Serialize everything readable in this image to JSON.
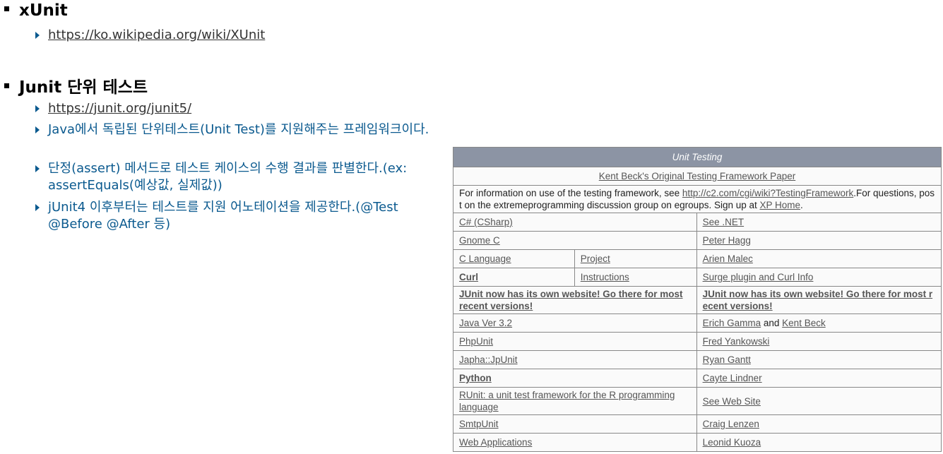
{
  "sections": [
    {
      "title": "xUnit",
      "bullets": [
        {
          "text": "https://ko.wikipedia.org/wiki/XUnit",
          "is_link": true
        }
      ]
    },
    {
      "title": "Junit 단위 테스트",
      "bullets": [
        {
          "text": "https://junit.org/junit5/",
          "is_link": true
        },
        {
          "text": "Java에서 독립된 단위테스트(Unit Test)를 지원해주는 프레임워크이다.",
          "is_link": false
        },
        {
          "text": "단정(assert) 메서드로 테스트 케이스의 수행 결과를 판별한다.(ex: assertEquals(예상값, 실제값))",
          "is_link": false
        },
        {
          "text": "jUnit4 이후부터는 테스트를 지원 어노테이션을 제공한다.(@Test @Before @After 등)",
          "is_link": false
        }
      ]
    }
  ],
  "table": {
    "header": "Unit Testing",
    "paper_link": "Kent Beck's Original Testing Framework Paper",
    "info": {
      "prefix": "For information on use of the testing framework, see ",
      "link1": "http://c2.com/cgi/wiki?TestingFramework",
      "middle": ".For questions, post on the extremeprogramming discussion group on egroups. Sign up at ",
      "link2": "XP Home",
      "suffix": "."
    },
    "rows": {
      "csharp": {
        "left": "C# (CSharp)",
        "right": "See .NET"
      },
      "gnome": {
        "left": "Gnome C",
        "right": "Peter Hagg"
      },
      "clang": {
        "left": "C Language",
        "mid": "Project",
        "right": "Arien Malec"
      },
      "curl": {
        "left": "Curl",
        "mid": "Instructions",
        "right": "Surge plugin and Curl Info"
      },
      "junit": {
        "left": "JUnit now has its own website! Go there for most recent versions!",
        "right": "JUnit now has its own website! Go there for most recent versions!"
      },
      "java": {
        "left": "Java Ver 3.2",
        "right_a": "Erich Gamma",
        "right_and": "and",
        "right_b": "Kent Beck"
      },
      "php": {
        "left": "PhpUnit",
        "right": "Fred Yankowski"
      },
      "japha": {
        "left": "Japha::JpUnit",
        "right": "Ryan Gantt"
      },
      "python": {
        "left": "Python",
        "right": "Cayte Lindner"
      },
      "runit": {
        "left": "RUnit: a unit test framework for the R programming language",
        "right": "See Web Site"
      },
      "smtp": {
        "left": "SmtpUnit",
        "right": "Craig Lenzen"
      },
      "web": {
        "left": "Web Applications",
        "right": "Leonid Kuoza"
      }
    }
  }
}
